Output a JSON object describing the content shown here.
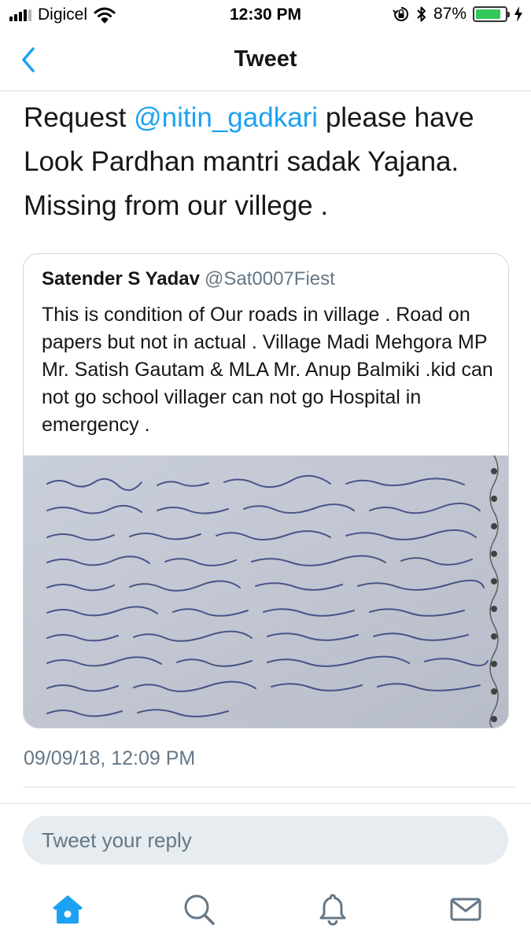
{
  "status_bar": {
    "carrier": "Digicel",
    "time": "12:30 PM",
    "battery_percent": "87%",
    "battery_level": 0.87,
    "signal_bars": 4,
    "icons": [
      "signal-icon",
      "wifi-icon",
      "orientation-lock-icon",
      "bluetooth-icon",
      "battery-icon",
      "charging-bolt-icon"
    ]
  },
  "nav": {
    "title": "Tweet",
    "back_icon": "chevron-left-icon"
  },
  "tweet": {
    "text_before_mention": "Request ",
    "mention": "@nitin_gadkari",
    "text_after_mention": " please have Look Pardhan mantri sadak Yajana. Missing from our villege ."
  },
  "quoted_tweet": {
    "name": "Satender S Yadav",
    "handle": "@Sat0007Fiest",
    "text": "This is condition of Our roads in village . Road on papers but not in actual . Village Madi Mehgora MP Mr. Satish Gautam & MLA Mr. Anup Balmiki .kid can not go school villager can not go Hospital in emergency ."
  },
  "timestamp": "09/09/18, 12:09 PM",
  "reply": {
    "placeholder": "Tweet your reply"
  },
  "tabbar": {
    "items": [
      "home-icon",
      "search-icon",
      "notifications-icon",
      "messages-icon"
    ]
  },
  "colors": {
    "accent": "#1da1f2",
    "secondary_text": "#657786",
    "battery": "#34c759"
  }
}
